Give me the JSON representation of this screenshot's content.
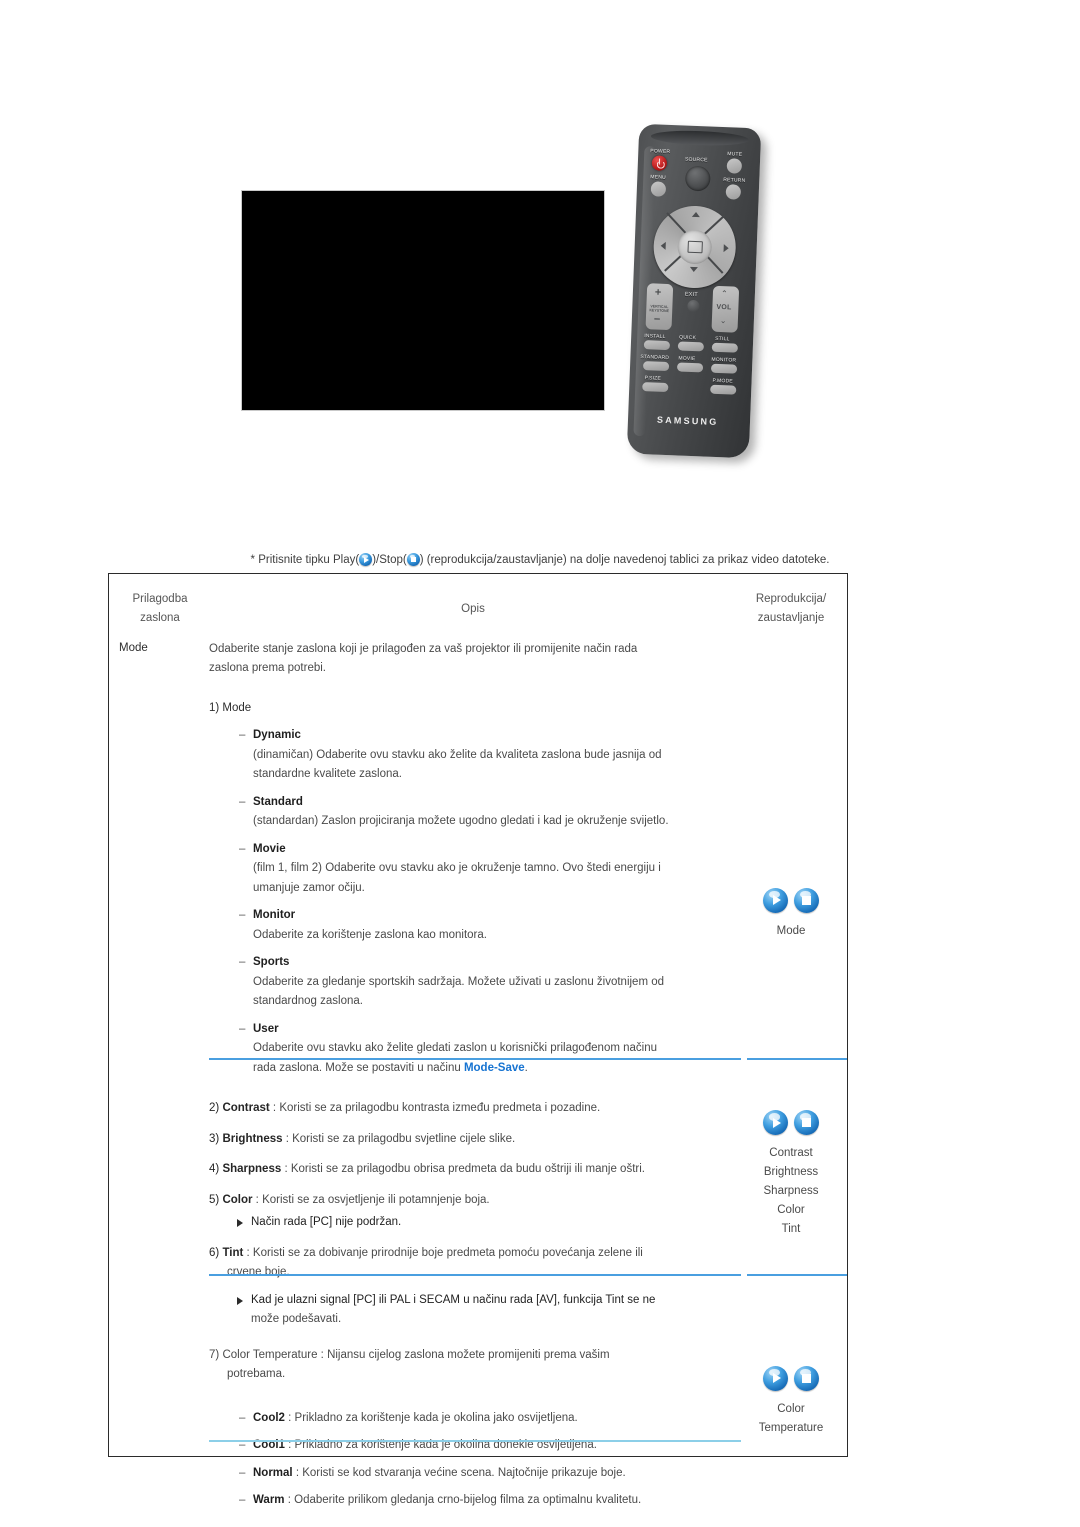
{
  "caption": {
    "prefix": "* Pritisnite tipku Play(",
    "mid": ")/Stop(",
    "suffix": ") (reprodukcija/zaustavljanje) na dolje navedenoj tablici za prikaz video datoteke."
  },
  "remote": {
    "brand": "SAMSUNG",
    "labels": {
      "power": "POWER",
      "source": "SOURCE",
      "mute": "MUTE",
      "menu": "MENU",
      "return": "RETURN",
      "exit": "EXIT",
      "vol": "VOL",
      "vertical_keystone": "VERTICAL KEYSTONE",
      "install": "INSTALL",
      "quick": "QUICK",
      "still": "STILL",
      "standard": "STANDARD",
      "movie": "MOVIE",
      "monitor": "MONITOR",
      "p_size": "P.SIZE",
      "p_mode": "P.MODE"
    }
  },
  "table": {
    "headers": {
      "left_line1": "Prilagodba",
      "left_line2": "zaslona",
      "middle": "Opis",
      "right_line1": "Reprodukcija/",
      "right_line2": "zaustavljanje"
    },
    "section1": {
      "left_label": "Mode",
      "intro_line1": "Odaberite stanje zaslona koji je prilagođen za vaš projektor ili promijenite način rada",
      "intro_line2": "zaslona prema potrebi.",
      "heading": "1) Mode",
      "items": [
        {
          "term": "Dynamic",
          "body_line1": "(dinamičan) Odaberite ovu stavku ako želite da kvaliteta zaslona bude jasnija od",
          "body_line2": "standardne kvalitete zaslona."
        },
        {
          "term": "Standard",
          "body_line1": "(standardan) Zaslon projiciranja možete ugodno gledati i kad je okruženje svijetlo.",
          "body_line2": ""
        },
        {
          "term": "Movie",
          "body_line1": "(film 1, film 2) Odaberite ovu stavku ako je okruženje tamno. Ovo štedi energiju i",
          "body_line2": "umanjuje zamor očiju."
        },
        {
          "term": "Monitor",
          "body_line1": "Odaberite za korištenje zaslona kao monitora.",
          "body_line2": ""
        },
        {
          "term": "Sports",
          "body_line1": "Odaberite za gledanje sportskih sadržaja. Možete uživati u zaslonu životnijem od",
          "body_line2": "standardnog zaslona."
        },
        {
          "term": "User",
          "body_line1": "Odaberite ovu stavku ako želite gledati zaslon u korisnički prilagođenom načinu",
          "body_line2": "rada zaslona. Može se postaviti u načinu ",
          "body_link": "Mode-Save",
          "body_line2_end": "."
        }
      ],
      "right_caption": "Mode"
    },
    "section2": {
      "entries": [
        {
          "num": "2)",
          "term": "Contrast",
          "sep": " : ",
          "text": "Koristi se za prilagodbu kontrasta između predmeta i pozadine."
        },
        {
          "num": "3)",
          "term": "Brightness",
          "sep": " : ",
          "text": "Koristi se za prilagodbu svjetline cijele slike."
        },
        {
          "num": "4)",
          "term": "Sharpness",
          "sep": " : ",
          "text": "Koristi se za prilagodbu obrisa predmeta da budu oštriji ili manje oštri."
        },
        {
          "num": "5)",
          "term": "Color",
          "sep": " : ",
          "text": "Koristi se za osvjetljenje ili potamnjenje boja."
        }
      ],
      "note1": "Način rada [PC] nije podržan.",
      "entry6": {
        "num": "6)",
        "term": "Tint",
        "sep": " : ",
        "text_line1": "Koristi se za dobivanje prirodnije boje predmeta pomoću povećanja zelene ili",
        "text_line2": "crvene boje."
      },
      "note2_line1": "Kad je ulazni signal [PC] ili PAL i SECAM u načinu rada [AV], funkcija Tint se ne",
      "note2_line2": "može podešavati.",
      "right_captions": [
        "Contrast",
        "Brightness",
        "Sharpness",
        "Color",
        "Tint"
      ]
    },
    "section3": {
      "heading_num": "7)",
      "heading_term": "Color Temperature",
      "heading_sep": " : ",
      "heading_text_line1": "Nijansu cijelog zaslona možete promijeniti prema vašim",
      "heading_text_line2": "potrebama.",
      "options": [
        {
          "term": "Cool2",
          "sep": " : ",
          "text": "Prikladno za korištenje kada je okolina jako osvijetljena."
        },
        {
          "term": "Cool1",
          "sep": " : ",
          "text": "Prikladno za korištenje kada je okolina donekle osvijetljena."
        },
        {
          "term": "Normal",
          "sep": " : ",
          "text": "Koristi se kod stvaranja većine scena. Najtočnije prikazuje boje."
        },
        {
          "term": "Warm",
          "sep": " : ",
          "text": "Odaberite prilikom gledanja crno-bijelog filma za optimalnu kvalitetu."
        }
      ],
      "right_caption_line1": "Color",
      "right_caption_line2": "Temperature"
    }
  },
  "colors": {
    "divider_blue": "#4a9fe0",
    "divider_teal": "#8ccfe8",
    "link_blue": "#1673d1",
    "sphere_blue": "#3f9ee0",
    "power_red": "#c01818"
  }
}
